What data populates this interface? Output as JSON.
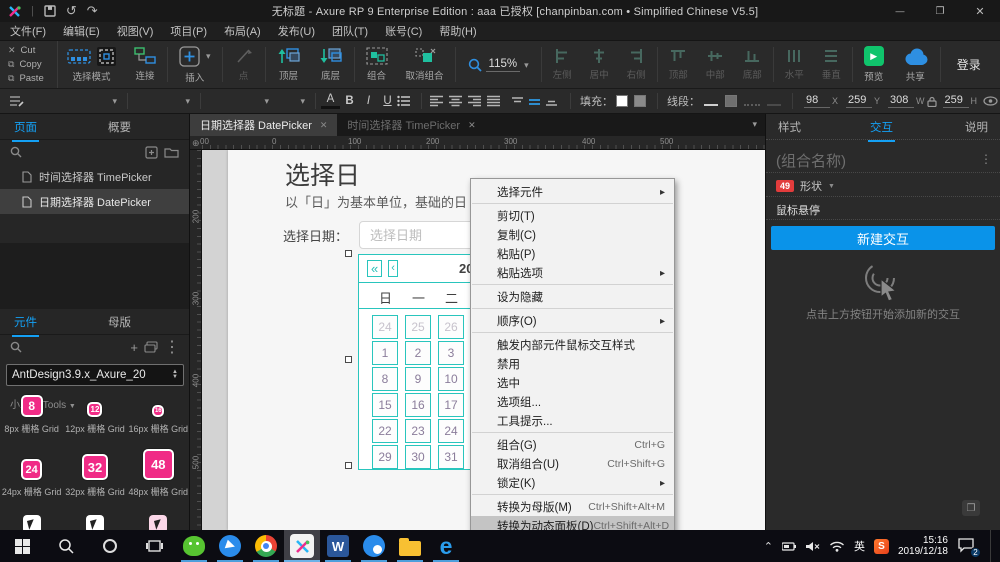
{
  "colors": {
    "accent_blue": "#14a0f4",
    "selection_teal": "#29c5bd",
    "widget_pink": "#f02b86",
    "badge_red": "#e23c3c",
    "preview_green": "#10c46c",
    "button_blue": "#0a93e9"
  },
  "titlebar": {
    "title": "无标题 - Axure RP 9 Enterprise Edition : aaa 已授权    [chanpinban.com • Simplified Chinese V5.5]"
  },
  "menubar": {
    "items": [
      {
        "label": "文件(F)"
      },
      {
        "label": "编辑(E)"
      },
      {
        "label": "视图(V)"
      },
      {
        "label": "项目(P)"
      },
      {
        "label": "布局(A)"
      },
      {
        "label": "发布(U)"
      },
      {
        "label": "团队(T)"
      },
      {
        "label": "账号(C)"
      },
      {
        "label": "帮助(H)"
      }
    ]
  },
  "clipboard": {
    "cut": "Cut",
    "copy": "Copy",
    "paste": "Paste"
  },
  "toolbar": {
    "select_mode": "选择模式",
    "connect": "连接",
    "insert": "插入",
    "point": "点",
    "top_layer": "顶层",
    "bottom_layer": "底层",
    "group": "组合",
    "ungroup": "取消组合",
    "zoom_value": "115%",
    "align_left": "左侧",
    "align_center": "居中",
    "align_right": "右侧",
    "align_top": "顶部",
    "align_middle": "中部",
    "align_bottom": "底部",
    "dist_h": "水平",
    "dist_v": "垂直",
    "preview": "预览",
    "share": "共享",
    "login": "登录"
  },
  "formatbar": {
    "color_btn": "A",
    "bold": "B",
    "italic": "I",
    "underline": "U",
    "fill_label": "填充：",
    "line_label": "线段：",
    "x_value": "98",
    "x_label": "X",
    "y_value": "259",
    "y_label": "Y",
    "w_value": "308",
    "w_label": "W",
    "h_value": "259",
    "h_label": "H"
  },
  "pages_panel": {
    "tab_pages": "页面",
    "tab_outline": "概要",
    "items": [
      {
        "label": "时间选择器 TimePicker"
      },
      {
        "label": "日期选择器 DatePicker"
      }
    ]
  },
  "widgets_panel": {
    "tab_widgets": "元件",
    "tab_masters": "母版",
    "library_name": "AntDesign3.9.x_Axure_20",
    "section_label": "小工具 Tools",
    "items": [
      {
        "num": "8",
        "label": "8px 栅格 Grid"
      },
      {
        "num": "12",
        "label": "12px 栅格 Grid"
      },
      {
        "num": "16",
        "label": "16px 栅格 Grid"
      },
      {
        "num": "24",
        "label": "24px 栅格 Grid"
      },
      {
        "num": "32",
        "label": "32px 栅格 Grid"
      },
      {
        "num": "48",
        "label": "48px 栅格 Grid"
      }
    ]
  },
  "canvas": {
    "tabs": [
      {
        "label": "日期选择器 DatePicker"
      },
      {
        "label": "时间选择器 TimePicker"
      }
    ],
    "hruler": [
      "00",
      "0",
      "100",
      "200",
      "300",
      "400",
      "500"
    ],
    "vruler": [
      "200",
      "300",
      "400",
      "500"
    ],
    "heading": "选择日",
    "description": "以「日」为基本单位，基础的日",
    "field_label": "选择日期：",
    "input_placeholder": "选择日期",
    "calendar": {
      "prev_year": "«",
      "prev_month": "‹",
      "year_text": "20",
      "day_headers": [
        "日",
        "一",
        "二"
      ],
      "rows": [
        [
          "24",
          "25",
          "26"
        ],
        [
          "1",
          "2",
          "3"
        ],
        [
          "8",
          "9",
          "10"
        ],
        [
          "15",
          "16",
          "17"
        ],
        [
          "22",
          "23",
          "24"
        ],
        [
          "29",
          "30",
          "31"
        ]
      ]
    }
  },
  "context_menu": {
    "items": [
      {
        "label": "选择元件"
      },
      {
        "label": "剪切(T)"
      },
      {
        "label": "复制(C)"
      },
      {
        "label": "粘贴(P)"
      },
      {
        "label": "粘贴选项"
      },
      {
        "label": "设为隐藏"
      },
      {
        "label": "顺序(O)"
      },
      {
        "label": "触发内部元件鼠标交互样式"
      },
      {
        "label": "禁用"
      },
      {
        "label": "选中"
      },
      {
        "label": "选项组..."
      },
      {
        "label": "工具提示..."
      },
      {
        "label": "组合(G)",
        "shortcut": "Ctrl+G"
      },
      {
        "label": "取消组合(U)",
        "shortcut": "Ctrl+Shift+G"
      },
      {
        "label": "锁定(K)"
      },
      {
        "label": "转换为母版(M)",
        "shortcut": "Ctrl+Shift+Alt+M"
      },
      {
        "label": "转换为动态面板(D)",
        "shortcut": "Ctrl+Shift+Alt+D"
      }
    ]
  },
  "interactions_panel": {
    "tab_style": "样式",
    "tab_interactions": "交互",
    "tab_notes": "说明",
    "group_name_placeholder": "(组合名称)",
    "shape_count": "49",
    "shape_label": "形状",
    "trigger_label": "鼠标悬停",
    "new_interaction_button": "新建交互",
    "hint": "点击上方按钮开始添加新的交互"
  },
  "taskbar": {
    "ime": "英",
    "sogou": "S",
    "time": "15:16",
    "date": "2019/12/18",
    "notification_count": "2",
    "word_letter": "W",
    "edge_letter": "e"
  }
}
